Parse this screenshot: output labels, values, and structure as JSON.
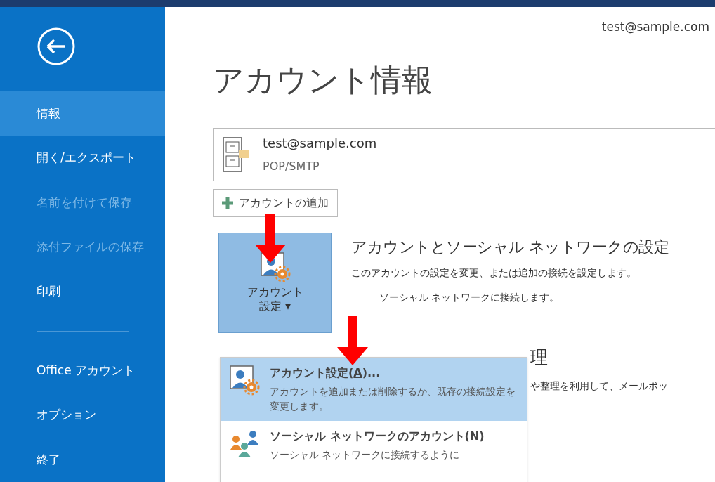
{
  "user_email": "test@sample.com",
  "sidebar": {
    "items": [
      {
        "label": "情報",
        "selected": true,
        "disabled": false
      },
      {
        "label": "開く/エクスポート",
        "selected": false,
        "disabled": false
      },
      {
        "label": "名前を付けて保存",
        "selected": false,
        "disabled": true
      },
      {
        "label": "添付ファイルの保存",
        "selected": false,
        "disabled": true
      },
      {
        "label": "印刷",
        "selected": false,
        "disabled": false
      },
      {
        "kind": "divider"
      },
      {
        "label": "Office アカウント",
        "selected": false,
        "disabled": false
      },
      {
        "label": "オプション",
        "selected": false,
        "disabled": false
      },
      {
        "label": "終了",
        "selected": false,
        "disabled": false
      }
    ]
  },
  "page_title": "アカウント情報",
  "account": {
    "email": "test@sample.com",
    "type": "POP/SMTP"
  },
  "add_account_button": "アカウントの追加",
  "account_settings_button": {
    "line1": "アカウント",
    "line2": "設定",
    "caret": "▾",
    "expanded": true
  },
  "section": {
    "heading": "アカウントとソーシャル ネットワークの設定",
    "lines": [
      "このアカウントの設定を変更、または追加の接続を設定します。",
      "ソーシャル ネットワークに接続します。"
    ]
  },
  "hidden_section": {
    "heading_fragment": "理",
    "text_fragment": "や整理を利用して、メールボッ"
  },
  "menu": {
    "items": [
      {
        "kind": "settings",
        "label_before": "アカウント設定(",
        "access_key": "A",
        "label_after": ")...",
        "description": "アカウントを追加または削除するか、既存の接続設定を変更します。",
        "selected": true
      },
      {
        "kind": "social",
        "label_before": "ソーシャル ネットワークのアカウント(",
        "access_key": "N",
        "label_after": ")",
        "description": "ソーシャル ネットワークに接続するように",
        "selected": false
      }
    ]
  }
}
